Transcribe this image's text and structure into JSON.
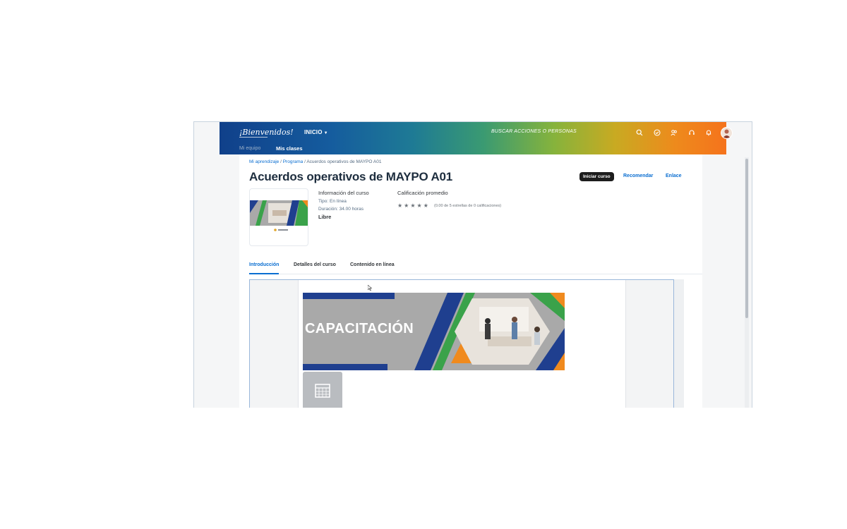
{
  "header": {
    "logo_text": "¡Bienvenidos!",
    "home_menu": "INICIO",
    "search_placeholder": "BUSCAR ACCIONES O PERSONAS",
    "icons": [
      "search-icon",
      "check-circle-icon",
      "people-icon",
      "headset-icon",
      "bell-icon"
    ],
    "gradient_colors": [
      "#10408a",
      "#3a9a72",
      "#86b33c",
      "#f5731c"
    ]
  },
  "subnav": {
    "team": "Mi equipo",
    "classes": "Mis clases"
  },
  "breadcrumb": {
    "items": [
      "Mi aprendizaje",
      "Programa"
    ],
    "current": "Acuerdos operativos de MAYPO A01",
    "separator": "/"
  },
  "course": {
    "title": "Acuerdos operativos de MAYPO A01",
    "actions": {
      "start": "Iniciar curso",
      "recommend": "Recomendar",
      "link": "Enlace"
    },
    "info": {
      "heading": "Información del curso",
      "type": "Tipo: En línea",
      "duration": "Duración: 34.00 horas",
      "price": "Libre"
    },
    "rating": {
      "heading": "Calificación promedio",
      "stars": "★★★★★",
      "summary": "(0.00 de 5 estrellas de 0 calificaciones)",
      "value": 0,
      "max": 5
    }
  },
  "tabs": [
    {
      "label": "Introducción",
      "active": true
    },
    {
      "label": "Detalles del curso",
      "active": false
    },
    {
      "label": "Contenido en línea",
      "active": false
    }
  ],
  "preview": {
    "banner_text": "CAPACITACIÓN"
  },
  "colors": {
    "accent": "#0a6ed1",
    "banner_gray": "#a9a9a9",
    "banner_blue": "#1f3f8f",
    "banner_green": "#3aa24a",
    "banner_orange": "#f08a1e"
  }
}
